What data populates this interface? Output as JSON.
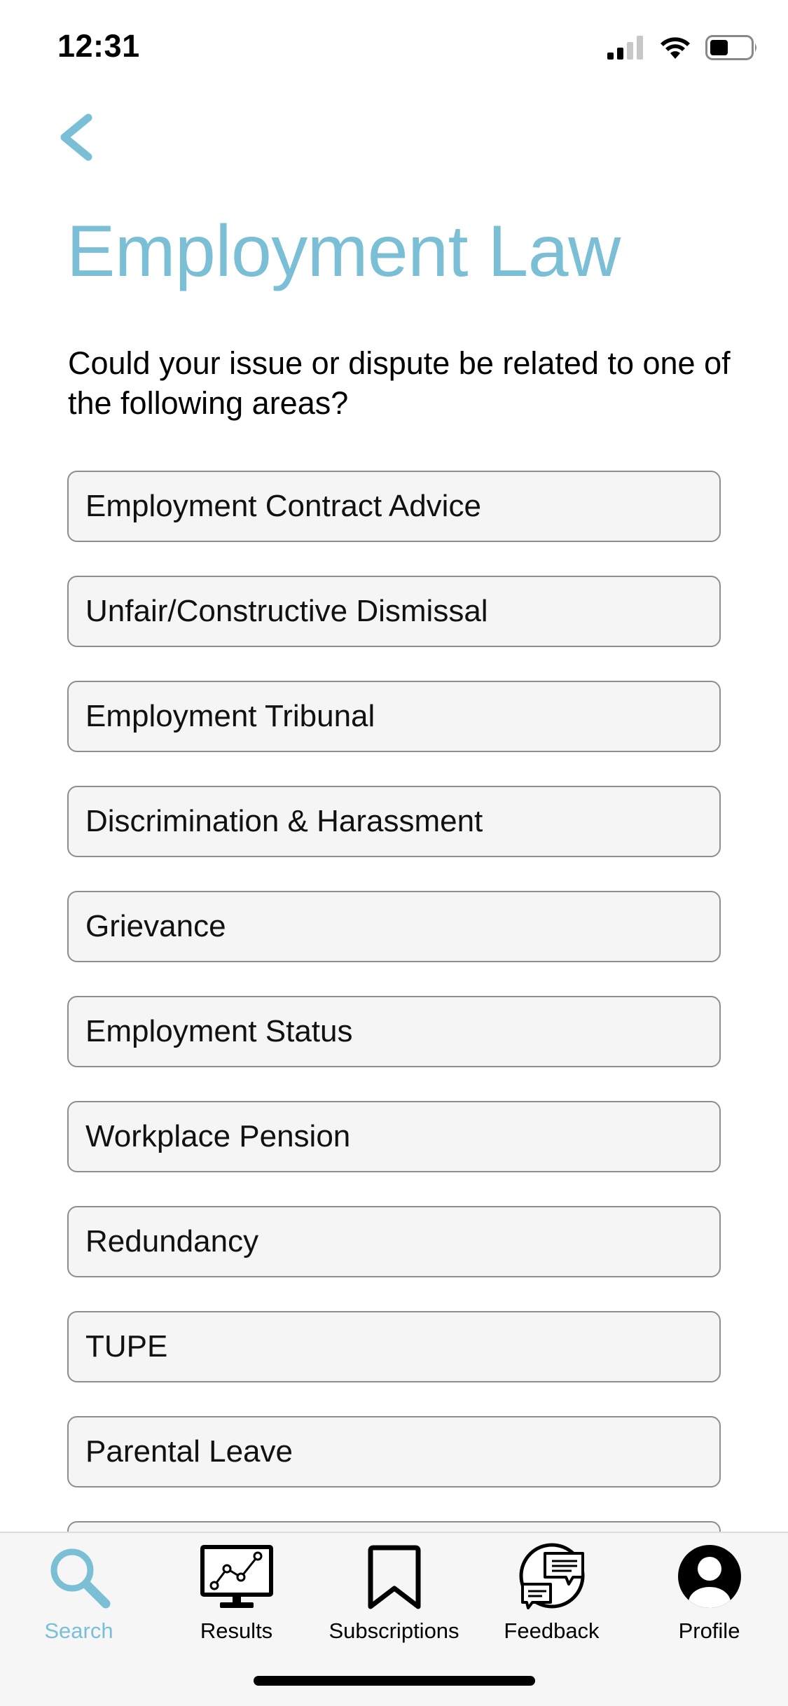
{
  "status_bar": {
    "time": "12:31",
    "icons": [
      "cellular-signal-icon",
      "wifi-icon",
      "battery-icon"
    ]
  },
  "header": {
    "back_icon": "chevron-left-icon",
    "title": "Employment Law"
  },
  "question": "Could your issue or dispute be related to one of the following areas?",
  "options": [
    "Employment Contract Advice",
    "Unfair/Constructive Dismissal",
    "Employment Tribunal",
    "Discrimination & Harassment",
    "Grievance",
    "Employment Status",
    "Workplace Pension",
    "Redundancy",
    "TUPE",
    "Parental Leave",
    ""
  ],
  "tab_bar": {
    "active": "Search",
    "tabs": [
      {
        "label": "Search",
        "icon": "search-icon"
      },
      {
        "label": "Results",
        "icon": "results-chart-icon"
      },
      {
        "label": "Subscriptions",
        "icon": "bookmark-icon"
      },
      {
        "label": "Feedback",
        "icon": "feedback-chat-icon"
      },
      {
        "label": "Profile",
        "icon": "profile-avatar-icon"
      }
    ]
  },
  "colors": {
    "accent": "#7abfd6",
    "option_background": "#f5f5f5",
    "option_border": "#8e8e8e",
    "tab_bar_background": "#f6f6f6"
  }
}
